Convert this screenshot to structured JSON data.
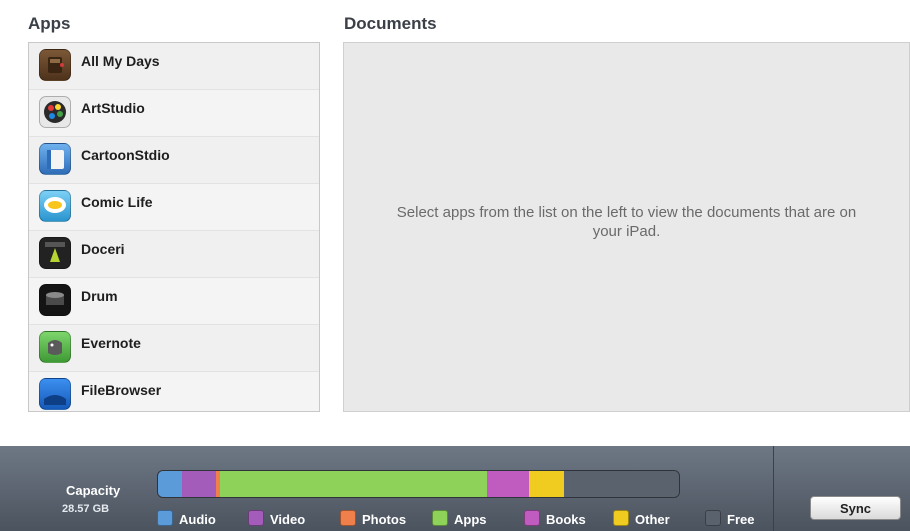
{
  "header": {
    "clipped_text": ""
  },
  "apps": {
    "title": "Apps",
    "items": [
      {
        "label": "All My Days",
        "icon": "journal-icon",
        "color": "#6b4a2b"
      },
      {
        "label": "ArtStudio",
        "icon": "palette-icon",
        "color": "#2a2a2a"
      },
      {
        "label": "CartoonStdio",
        "icon": "cartoon-canvas-icon",
        "color": "#3c7fc9"
      },
      {
        "label": "Comic Life",
        "icon": "comic-speech-icon",
        "color": "#3aa6dd"
      },
      {
        "label": "Doceri",
        "icon": "doceri-icon",
        "color": "#2b2b2b"
      },
      {
        "label": "Drum",
        "icon": "drum-icon",
        "color": "#1c1c1c"
      },
      {
        "label": "Evernote",
        "icon": "elephant-icon",
        "color": "#55a84a"
      },
      {
        "label": "FileBrowser",
        "icon": "filebrowser-icon",
        "color": "#1e6fd6"
      }
    ]
  },
  "documents": {
    "title": "Documents",
    "message": "Select apps from the list on the left to view the documents that are on your iPad."
  },
  "capacity": {
    "label": "Capacity",
    "value": "28.57 GB",
    "segments": [
      {
        "name": "Audio",
        "fraction": 0.046,
        "color": "#5b9bd9"
      },
      {
        "name": "Video",
        "fraction": 0.066,
        "color": "#a35cb9"
      },
      {
        "name": "Photos",
        "fraction": 0.008,
        "color": "#f0804b"
      },
      {
        "name": "Apps",
        "fraction": 0.511,
        "color": "#8ed25a"
      },
      {
        "name": "Books",
        "fraction": 0.082,
        "color": "#c05bbf"
      },
      {
        "name": "Other",
        "fraction": 0.067,
        "color": "#f0cc21"
      },
      {
        "name": "Free",
        "fraction": 0.22,
        "color": "#5a626e"
      }
    ],
    "legend": [
      {
        "label": "Audio",
        "color": "#5b9bd9"
      },
      {
        "label": "Video",
        "color": "#a35cb9"
      },
      {
        "label": "Photos",
        "color": "#f0804b"
      },
      {
        "label": "Apps",
        "color": "#8ed25a"
      },
      {
        "label": "Books",
        "color": "#c05bbf"
      },
      {
        "label": "Other",
        "color": "#f0cc21"
      },
      {
        "label": "Free",
        "color": "#5a626e"
      }
    ]
  },
  "actions": {
    "sync_label": "Sync"
  }
}
